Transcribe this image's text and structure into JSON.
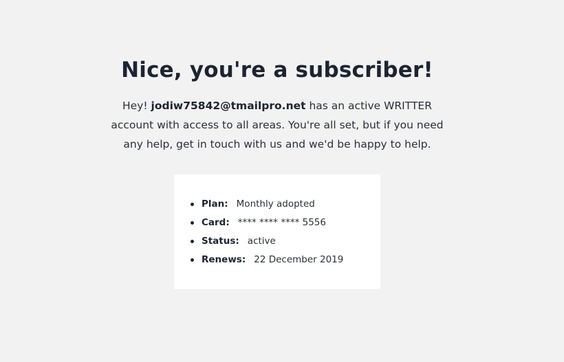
{
  "headline": "Nice, you're a subscriber!",
  "intro": {
    "greeting": "Hey!",
    "email": "jodiw75842@tmailpro.net",
    "message": "has an active WRITTER account with access to all areas. You're all set, but if you need any help, get in touch with us and we'd be happy to help."
  },
  "subscription": [
    {
      "label": "Plan:",
      "value": "Monthly adopted"
    },
    {
      "label": "Card:",
      "value": "**** **** **** 5556"
    },
    {
      "label": "Status:",
      "value": "active"
    },
    {
      "label": "Renews:",
      "value": "22 December 2019"
    }
  ]
}
